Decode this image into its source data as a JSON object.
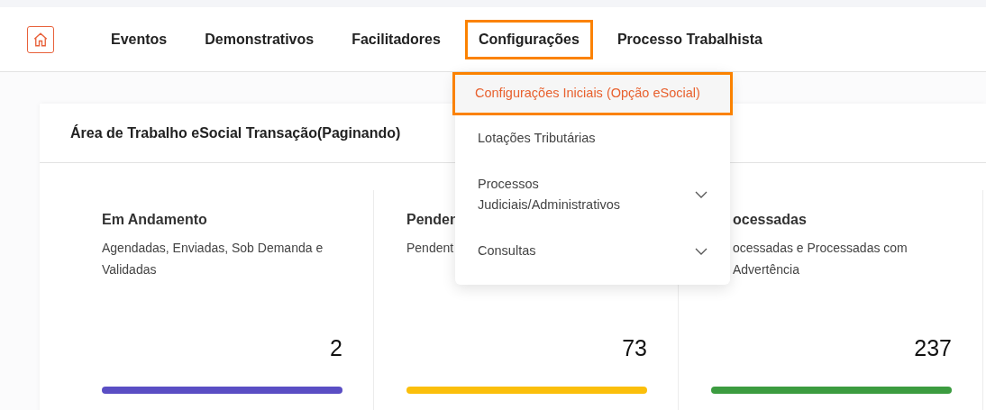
{
  "nav": {
    "items": [
      {
        "label": "Eventos",
        "selected": false
      },
      {
        "label": "Demonstrativos",
        "selected": false
      },
      {
        "label": "Facilitadores",
        "selected": false
      },
      {
        "label": "Configurações",
        "selected": true
      },
      {
        "label": "Processo Trabalhista",
        "selected": false
      }
    ]
  },
  "menu": {
    "items": [
      {
        "label": "Configurações Iniciais (Opção eSocial)",
        "selected": true,
        "expandable": false
      },
      {
        "label": "Lotações Tributárias",
        "selected": false,
        "expandable": false
      },
      {
        "label": "Processos Judiciais/Administrativos",
        "selected": false,
        "expandable": true
      },
      {
        "label": "Consultas",
        "selected": false,
        "expandable": true
      }
    ]
  },
  "panel": {
    "title": "Área de Trabalho eSocial Transação(Paginando)",
    "cards": [
      {
        "title": "Em Andamento",
        "description": "Agendadas, Enviadas, Sob Demanda e Validadas",
        "count": "2",
        "color": "#5a4ec4"
      },
      {
        "title": "Penden",
        "description": "Pendent",
        "count": "73",
        "color": "#fbbf0b"
      },
      {
        "title": "ocessadas",
        "description": "ocessadas e Processadas com Advertência",
        "count": "237",
        "color": "#3c9c40"
      }
    ]
  }
}
